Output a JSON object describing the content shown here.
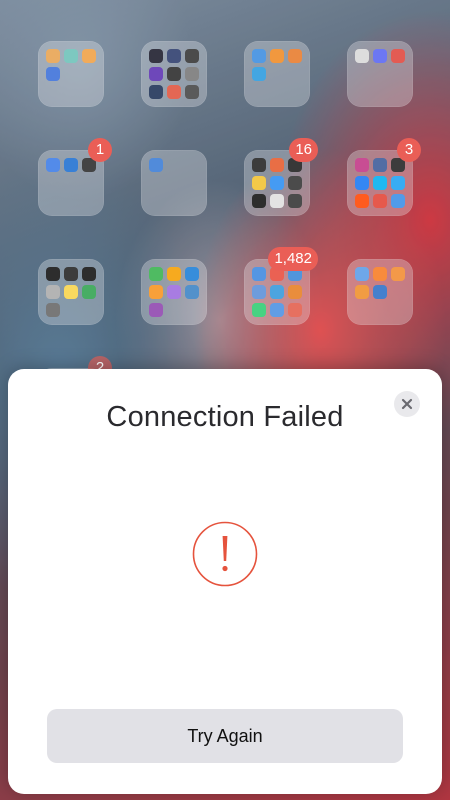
{
  "home_screen": {
    "folders": [
      {
        "id": "f1",
        "badge": null,
        "icons": [
          "#e7a24f",
          "#6cc1b8",
          "#f0a044",
          "#3b6fd9"
        ]
      },
      {
        "id": "f2",
        "badge": null,
        "icons": [
          "#1a1a2a",
          "#2b3b6b",
          "#333",
          "#5b2fb1",
          "#2a2a2a",
          "#777",
          "#1b2f55",
          "#e0533d",
          "#444"
        ]
      },
      {
        "id": "f3",
        "badge": null,
        "icons": [
          "#3c8de0",
          "#f08a24",
          "#e77a2b",
          "#2a9adf"
        ]
      },
      {
        "id": "f4",
        "badge": null,
        "icons": [
          "#d9d9d9",
          "#5865f2",
          "#e0453c"
        ]
      },
      {
        "id": "f5",
        "badge": "1",
        "icons": [
          "#3c7be6",
          "#1d6fd1",
          "#2b2b2b"
        ]
      },
      {
        "id": "f6",
        "badge": null,
        "icons": [
          "#3a7bd5"
        ]
      },
      {
        "id": "f7",
        "badge": "16",
        "icons": [
          "#222",
          "#e65a2c",
          "#1d1d1d",
          "#f2c230",
          "#2c8ef2",
          "#333",
          "#111",
          "#e0e0e0",
          "#333"
        ]
      },
      {
        "id": "f8",
        "badge": "3",
        "icons": [
          "#c13584",
          "#3b5998",
          "#222",
          "#1877f2",
          "#00aff0",
          "#1da1f2",
          "#ff4500",
          "#e34234",
          "#3a8ee6"
        ]
      },
      {
        "id": "f9",
        "badge": null,
        "icons": [
          "#111",
          "#222",
          "#111",
          "#aaa",
          "#f7d44a",
          "#2fa24f",
          "#666"
        ]
      },
      {
        "id": "f10",
        "badge": null,
        "icons": [
          "#37b24d",
          "#f59f00",
          "#1c7ed6",
          "#f7931e",
          "#9c6ade",
          "#3b82c4",
          "#8e44ad"
        ]
      },
      {
        "id": "f11",
        "badge": "1,482",
        "icons": [
          "#3d88e0",
          "#e74c3c",
          "#3a87d8",
          "#5a8fd8",
          "#3498db",
          "#e67e22",
          "#2ecc71",
          "#4a90e2",
          "#e35d4a"
        ]
      },
      {
        "id": "f12",
        "badge": null,
        "icons": [
          "#5a9be6",
          "#f77b21",
          "#f28b30",
          "#ef8f2a",
          "#2c6fc7"
        ]
      },
      {
        "id": "f13",
        "badge": "2",
        "icons": []
      }
    ]
  },
  "dialog": {
    "title": "Connection Failed",
    "primary_button": "Try Again",
    "close_label": "close",
    "alert_color": "#e5533d"
  }
}
